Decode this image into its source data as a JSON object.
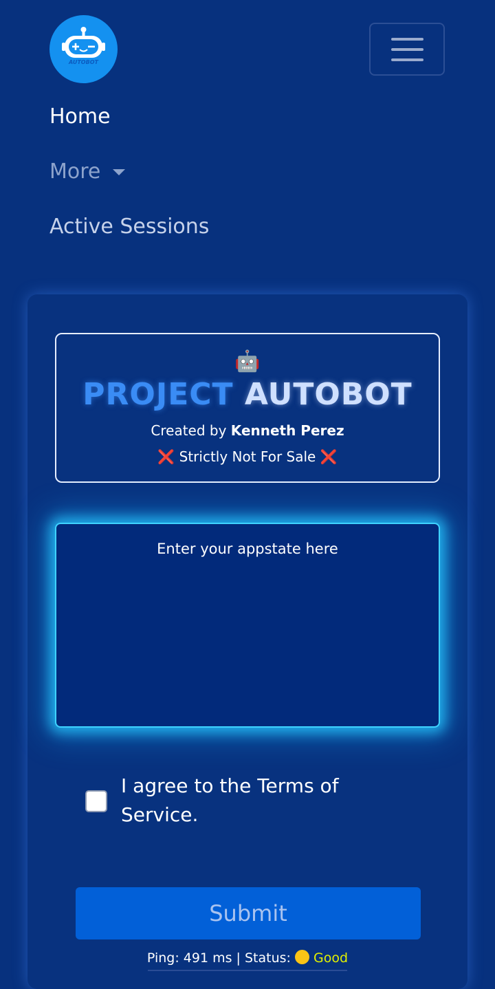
{
  "header": {
    "logo_text": "AUTOBOT",
    "menu_icon": "hamburger-menu-icon"
  },
  "nav": {
    "home": "Home",
    "more": "More",
    "active_sessions": "Active Sessions"
  },
  "card": {
    "emoji": "🤖",
    "title_part1": "PROJECT",
    "title_part2": "AUTOBOT",
    "creator_prefix": "Created by",
    "creator_name": "Kenneth Perez",
    "x_mark": "❌",
    "not_for_sale": "Strictly Not For Sale",
    "appstate_placeholder": "Enter your appstate here",
    "appstate_value": "",
    "terms_label": "I agree to the Terms of Service.",
    "terms_checked": false,
    "submit_label": "Submit"
  },
  "status_bar": {
    "ping_label": "Ping:",
    "ping_value": "491 ms",
    "separator": "|",
    "status_label": "Status:",
    "status_value": "Good",
    "status_color": "#fbc416"
  },
  "colors": {
    "background": "#07317e",
    "accent_glow": "#3fd2ff",
    "button": "#0260d8",
    "logo_bg": "#1491f0"
  }
}
